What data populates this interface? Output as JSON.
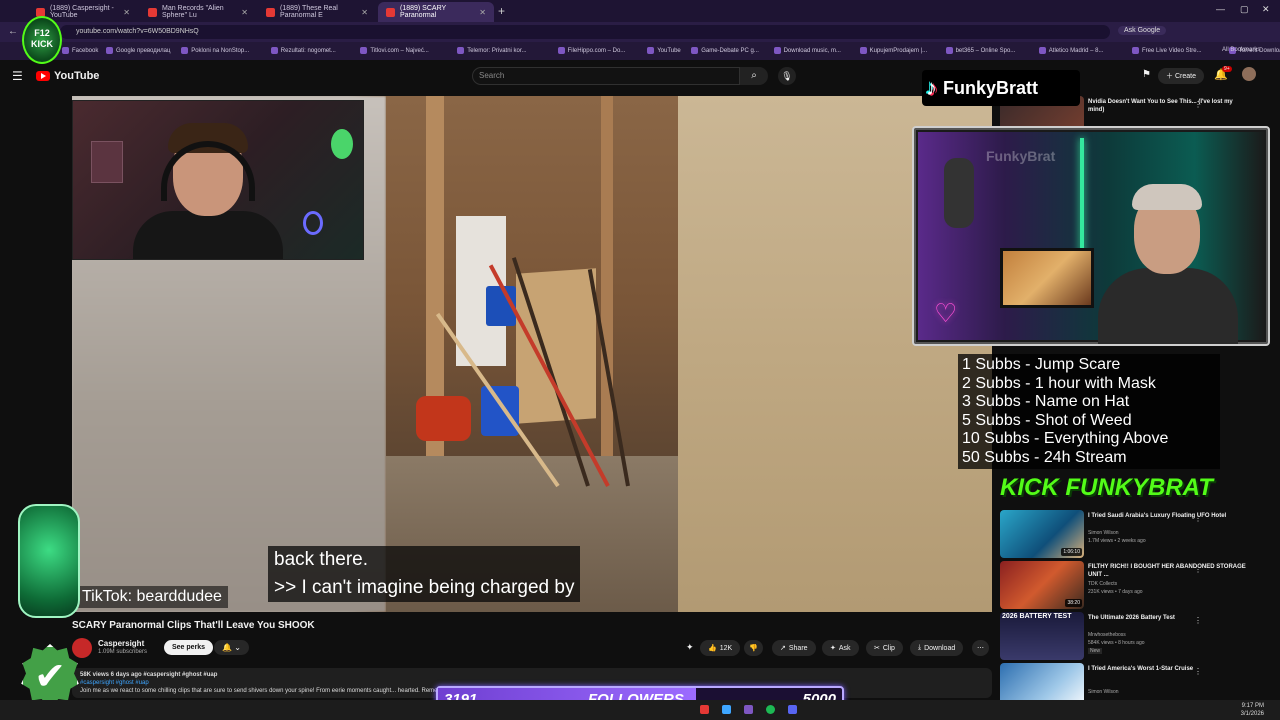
{
  "browser": {
    "tabs": [
      {
        "label": "(1889) Caspersight - YouTube",
        "active": false
      },
      {
        "label": "Man Records \"Alien Sphere\" Lu",
        "active": false
      },
      {
        "label": "(1889) These Real Paranormal E",
        "active": false
      },
      {
        "label": "(1889) SCARY Paranormal",
        "active": true
      }
    ],
    "url": "youtube.com/watch?v=6W50BD9NHsQ",
    "ask_google": "Ask Google",
    "bookmarks": [
      "Facebook",
      "Google преводилац",
      "Pokloni na NonStop...",
      "Rezultati: nogomet...",
      "Titlovi.com – Najveć...",
      "Telemor: Privatni kor...",
      "FileHippo.com – Do...",
      "YouTube",
      "Game-Debate PC g...",
      "Download music, m...",
      "KupujemProdajem |...",
      "bet365 – Online Spo...",
      "Atletico Madrid – 8...",
      "Free Live Video Stre...",
      "Torrent Downloads..."
    ],
    "all_bookmarks": "All Bookmarks"
  },
  "youtube": {
    "logo": "YouTube",
    "search_placeholder": "Search",
    "create_label": "Create",
    "notif_count": "9+"
  },
  "video": {
    "caption_line1": "back there.",
    "caption_line2": ">> I can't imagine being charged by",
    "tiktok_handle": "TikTok: bearddudee",
    "title": "SCARY Paranormal Clips That'll Leave You SHOOK",
    "channel": "Caspersight",
    "subscribers": "1.09M subscribers",
    "see_perks": "See perks",
    "likes": "12K",
    "share": "Share",
    "ask": "Ask",
    "clip": "Clip",
    "download": "Download",
    "desc_meta": "58K views  6 days ago  #caspersight #ghost #uap",
    "desc_tags": "#caspersight #ghost #uap",
    "desc_text": "Join me as we react to some chilling clips that are sure to send shivers down your spine! From eerie moments caught...  hearted. Remember, don't watch alone... know what you think below! 👻"
  },
  "sidebar": {
    "recs": [
      {
        "title": "Nvidia Doesn't Want You to See This... (I've lost my mind)",
        "channel": "",
        "meta": "",
        "duration": "",
        "badge": ""
      },
      {
        "title": "I Tried Saudi Arabia's Luxury Floating UFO Hotel",
        "channel": "Simon Wilson",
        "meta": "1.7M views • 2 weeks ago",
        "duration": "1:06:10",
        "badge": ""
      },
      {
        "title": "FILTHY RICH!! I BOUGHT HER ABANDONED STORAGE UNIT ...",
        "channel": "TDK Collects",
        "meta": "231K views • 7 days ago",
        "duration": "38:20",
        "badge": ""
      },
      {
        "title": "The Ultimate 2026 Battery Test",
        "channel": "Mrwhosetheboss",
        "meta": "584K views • 8 hours ago",
        "duration": "",
        "badge": "New",
        "thumb_text": "2026 BATTERY TEST"
      },
      {
        "title": "I Tried America's Worst 1-Star Cruise",
        "channel": "Simon Wilson",
        "meta": "",
        "duration": "",
        "badge": ""
      }
    ]
  },
  "overlay": {
    "tiktok_name": "FunkyBratt",
    "goals": [
      "1 Subbs - Jump Scare",
      "2 Subbs - 1 hour with Mask",
      "3 Subbs - Name on Hat",
      "5 Subbs - Shot of Weed",
      "10 Subbs - Everything Above",
      "50 Subbs - 24h Stream"
    ],
    "kick_logo": "KICK FUNKYBRAT",
    "f12_badge": "F12 KICK",
    "followers_current": "3191",
    "followers_label": "FOLLOWERS",
    "followers_goal": "5000",
    "followers_progress": 0.638,
    "webcam_text": "FunkyBrat"
  },
  "taskbar": {
    "time": "9:17 PM",
    "date": "3/1/2026"
  },
  "colors": {
    "yt_red": "#ff0000",
    "kick_green": "#53fc18",
    "followers_purple": "#7b5cff",
    "link_blue": "#3ea6ff"
  }
}
